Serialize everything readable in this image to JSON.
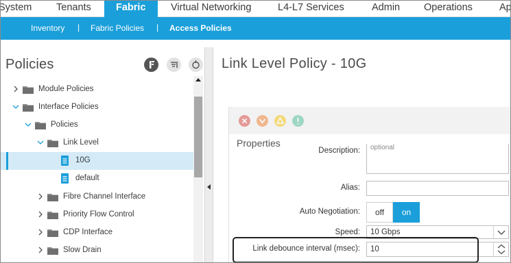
{
  "topnav": {
    "items": [
      {
        "label": "System",
        "active": false
      },
      {
        "label": "Tenants",
        "active": false
      },
      {
        "label": "Fabric",
        "active": true
      },
      {
        "label": "Virtual Networking",
        "active": false
      },
      {
        "label": "L4-L7 Services",
        "active": false
      },
      {
        "label": "Admin",
        "active": false
      },
      {
        "label": "Operations",
        "active": false
      },
      {
        "label": "Ap",
        "active": false
      }
    ]
  },
  "subnav": {
    "items": [
      {
        "label": "Inventory",
        "active": false
      },
      {
        "label": "Fabric Policies",
        "active": false
      },
      {
        "label": "Access Policies",
        "active": true
      }
    ],
    "separator": "|"
  },
  "left_pane": {
    "title": "Policies",
    "tools": [
      "info-icon",
      "filter-icon",
      "refresh-icon"
    ],
    "tree": [
      {
        "label": "Module Policies",
        "expanded": false,
        "kind": "folder",
        "level": 0
      },
      {
        "label": "Interface Policies",
        "expanded": true,
        "kind": "folder",
        "level": 0
      },
      {
        "label": "Policies",
        "expanded": true,
        "kind": "folder",
        "level": 1
      },
      {
        "label": "Link Level",
        "expanded": true,
        "kind": "folder",
        "level": 2
      },
      {
        "label": "10G",
        "kind": "document",
        "level": 3,
        "selected": true
      },
      {
        "label": "default",
        "kind": "document",
        "level": 3,
        "selected": false
      },
      {
        "label": "Fibre Channel Interface",
        "expanded": false,
        "kind": "folder",
        "level": 2
      },
      {
        "label": "Priority Flow Control",
        "expanded": false,
        "kind": "folder",
        "level": 2
      },
      {
        "label": "CDP Interface",
        "expanded": false,
        "kind": "folder",
        "level": 2
      },
      {
        "label": "Slow Drain",
        "expanded": false,
        "kind": "folder",
        "level": 2
      }
    ]
  },
  "right_pane": {
    "title": "Link Level Policy - 10G",
    "fault_icons": [
      "critical-fault-icon",
      "major-fault-icon",
      "minor-fault-icon",
      "warning-fault-icon"
    ],
    "properties_label": "Properties",
    "fields": {
      "description": {
        "label": "Description:",
        "placeholder": "optional"
      },
      "alias": {
        "label": "Alias:",
        "value": ""
      },
      "auto_negotiation": {
        "label": "Auto Negotiation:",
        "options": [
          "off",
          "on"
        ],
        "selected": "on"
      },
      "speed": {
        "label": "Speed:",
        "value": "10 Gbps"
      },
      "debounce": {
        "label": "Link debounce interval (msec):",
        "value": "10"
      }
    }
  },
  "colors": {
    "accent": "#1a9fda",
    "selected_row": "#d4ebf7",
    "highlight_border": "#222222"
  }
}
